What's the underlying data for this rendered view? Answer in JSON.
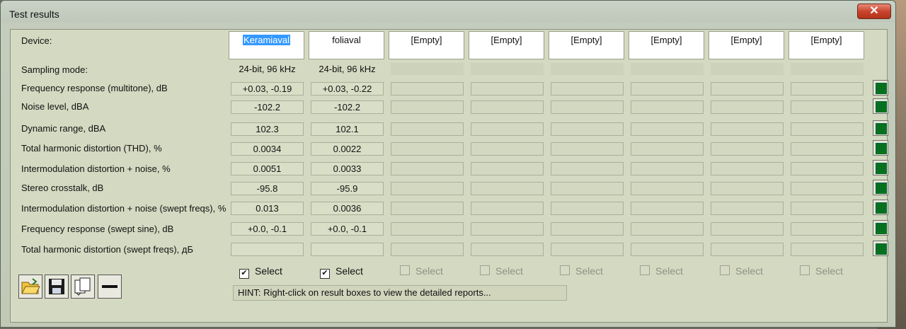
{
  "window": {
    "title": "Test results",
    "close_icon": "close-icon"
  },
  "device_label": "Device:",
  "devices": [
    "Keramiaval",
    "foliaval",
    "[Empty]",
    "[Empty]",
    "[Empty]",
    "[Empty]",
    "[Empty]",
    "[Empty]"
  ],
  "sampling": {
    "label": "Sampling mode:",
    "values": [
      "24-bit, 96 kHz",
      "24-bit, 96 kHz"
    ]
  },
  "rows": [
    {
      "label": "Frequency response (multitone), dB",
      "values": [
        "+0.03, -0.19",
        "+0.03, -0.22"
      ]
    },
    {
      "label": "Noise level, dBA",
      "values": [
        "-102.2",
        "-102.2"
      ]
    },
    {
      "label": "Dynamic range, dBA",
      "values": [
        "102.3",
        "102.1"
      ]
    },
    {
      "label": "Total harmonic distortion (THD), %",
      "values": [
        "0.0034",
        "0.0022"
      ]
    },
    {
      "label": "Intermodulation distortion + noise, %",
      "values": [
        "0.0051",
        "0.0033"
      ]
    },
    {
      "label": "Stereo crosstalk, dB",
      "values": [
        "-95.8",
        "-95.9"
      ]
    },
    {
      "label": "Intermodulation distortion + noise (swept freqs), %",
      "values": [
        "0.013",
        "0.0036"
      ]
    },
    {
      "label": "Frequency response (swept sine), dB",
      "values": [
        "+0.0, -0.1",
        "+0.0, -0.1"
      ]
    },
    {
      "label": "Total harmonic distortion (swept freqs), дБ",
      "values": [
        "",
        ""
      ]
    }
  ],
  "select": {
    "label": "Select",
    "checked": [
      true,
      true,
      false,
      false,
      false,
      false,
      false,
      false
    ]
  },
  "hint": "HINT: Right-click on result boxes to view the detailed reports...",
  "toolbar": [
    {
      "icon": "open-folder-icon"
    },
    {
      "icon": "save-icon"
    },
    {
      "icon": "copy-icon"
    },
    {
      "icon": "minus-icon"
    }
  ]
}
